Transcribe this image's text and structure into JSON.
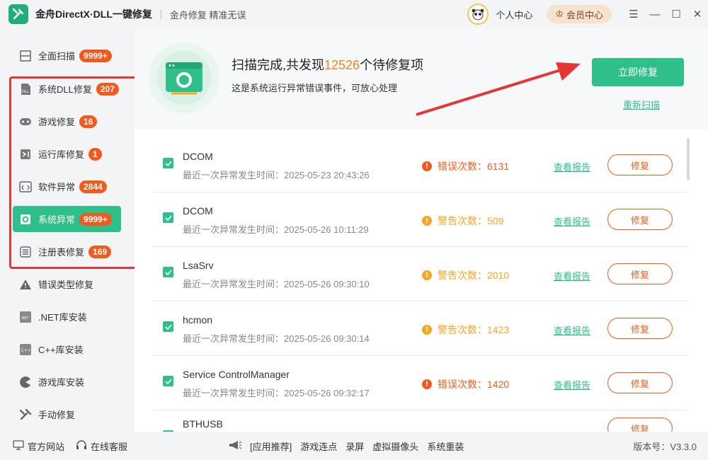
{
  "window": {
    "title": "金舟DirectX·DLL一键修复",
    "slogan": "金舟修复 精准无误",
    "user_center": "个人中心",
    "vip_center": "会员中心"
  },
  "sidebar": {
    "items": [
      {
        "label": "全面扫描",
        "badge": "9999+",
        "icon": "full-scan-icon"
      },
      {
        "label": "系统DLL修复",
        "badge": "207",
        "icon": "dll-icon"
      },
      {
        "label": "游戏修复",
        "badge": "16",
        "icon": "gamepad-icon"
      },
      {
        "label": "运行库修复",
        "badge": "1",
        "icon": "vs-runtime-icon"
      },
      {
        "label": "软件异常",
        "badge": "2844",
        "icon": "code-window-icon"
      },
      {
        "label": "系统异常",
        "badge": "9999+",
        "icon": "gear-icon"
      },
      {
        "label": "注册表修复",
        "badge": "169",
        "icon": "list-icon"
      },
      {
        "label": "错误类型修复",
        "badge": "",
        "icon": "warning-icon"
      },
      {
        "label": ".NET库安装",
        "badge": "",
        "icon": "dotnet-icon"
      },
      {
        "label": "C++库安装",
        "badge": "",
        "icon": "cpp-icon"
      },
      {
        "label": "游戏库安装",
        "badge": "",
        "icon": "pacman-icon"
      },
      {
        "label": "手动修复",
        "badge": "",
        "icon": "tools-icon"
      }
    ]
  },
  "banner": {
    "title_prefix": "扫描完成,共发现",
    "count": "12526",
    "title_suffix": "个待修复项",
    "subtitle": "这是系统运行异常错误事件，可放心处理",
    "fix_now": "立即修复",
    "rescan": "重新扫描"
  },
  "list": {
    "report_label": "查看报告",
    "fix_label": "修复",
    "rows": [
      {
        "name": "DCOM",
        "time": "最近一次异常发生时间：2025-05-23 20:43:26",
        "level": "错误次数：6131",
        "type": "error"
      },
      {
        "name": "DCOM",
        "time": "最近一次异常发生时间：2025-05-26 10:11:29",
        "level": "警告次数：509",
        "type": "warning"
      },
      {
        "name": "LsaSrv",
        "time": "最近一次异常发生时间：2025-05-26 09:30:10",
        "level": "警告次数：2010",
        "type": "warning"
      },
      {
        "name": "hcmon",
        "time": "最近一次异常发生时间：2025-05-26 09:30:14",
        "level": "警告次数：1423",
        "type": "warning"
      },
      {
        "name": "Service ControlManager",
        "time": "最近一次异常发生时间：2025-05-26 09:32:17",
        "level": "错误次数：1420",
        "type": "error"
      },
      {
        "name": "BTHUSB",
        "time": "",
        "level": "",
        "type": "warning"
      }
    ]
  },
  "statusbar": {
    "website": "官方网站",
    "support": "在线客服",
    "recommend": "[应用推荐]",
    "links": [
      "游戏连点",
      "录屏",
      "虚拟摄像头",
      "系统重装"
    ],
    "version": "版本号：V3.3.0"
  },
  "colors": {
    "accent": "#2fbf8a",
    "error": "#f25a1d",
    "warning": "#f5a623",
    "highlight": "#e53535"
  }
}
